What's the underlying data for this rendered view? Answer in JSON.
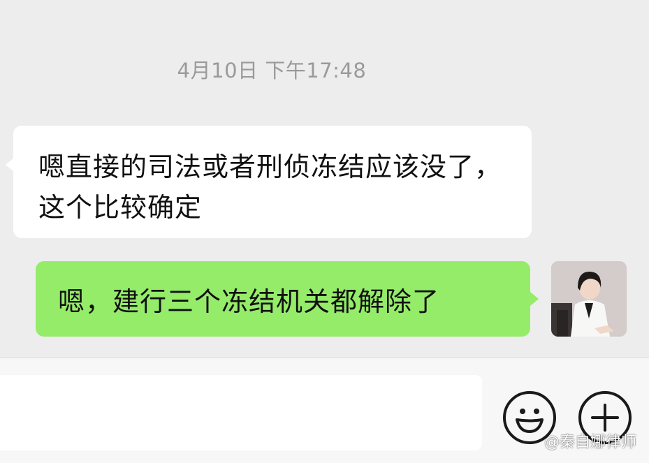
{
  "chat": {
    "timestamp": "4月10日 下午17:48",
    "messages": [
      {
        "side": "received",
        "text": "嗯直接的司法或者刑侦冻结应该没了，这个比较确定"
      },
      {
        "side": "sent",
        "text": "嗯，建行三个冻结机关都解除了"
      }
    ]
  },
  "input_bar": {
    "text_value": "",
    "emoji_icon": "smiley-face-icon",
    "plus_icon": "plus-circle-icon"
  },
  "watermark": {
    "text": "@秦自娜律师"
  },
  "colors": {
    "background": "#ededed",
    "received_bubble": "#ffffff",
    "sent_bubble": "#95ec69",
    "timestamp_text": "#9a9a9a"
  }
}
